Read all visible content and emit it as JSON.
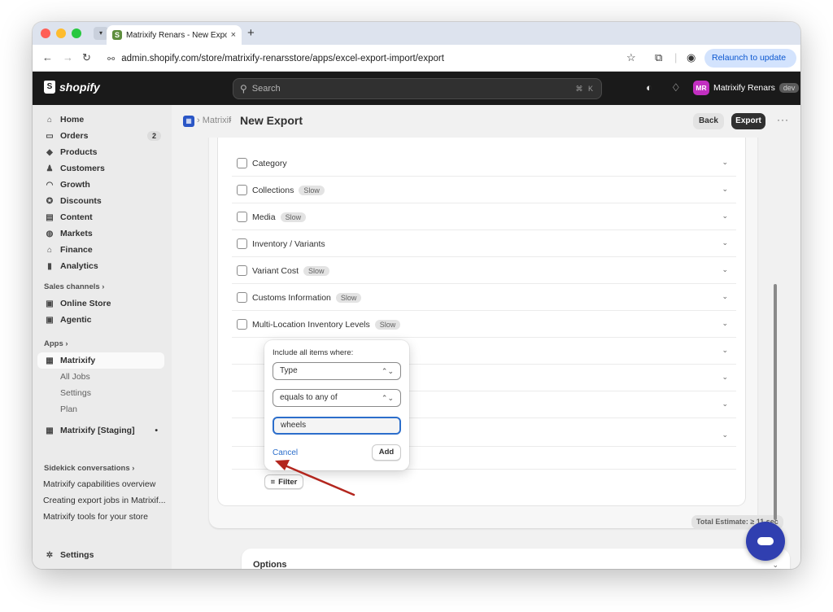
{
  "browser": {
    "tab_title": "Matrixify Renars - New Export",
    "tab_close": "×",
    "new_tab": "+",
    "url": "admin.shopify.com/store/matrixify-renarsstore/apps/excel-export-import/export",
    "relaunch_label": "Relaunch to update",
    "relaunch_menu": "⋮"
  },
  "shopify": {
    "logo_text": "shopify",
    "search_placeholder": "Search",
    "search_shortcut": "⌘ K",
    "avatar_initials": "MR",
    "store_name": "Matrixify Renars",
    "dev_badge": "dev"
  },
  "sidebar": {
    "nav": [
      {
        "label": "Home"
      },
      {
        "label": "Orders",
        "badge": "2"
      },
      {
        "label": "Products"
      },
      {
        "label": "Customers"
      },
      {
        "label": "Growth"
      },
      {
        "label": "Discounts"
      },
      {
        "label": "Content"
      },
      {
        "label": "Markets"
      },
      {
        "label": "Finance"
      },
      {
        "label": "Analytics"
      }
    ],
    "sales_channels_heading": "Sales channels ›",
    "sales_channels": [
      {
        "label": "Online Store"
      },
      {
        "label": "Agentic"
      }
    ],
    "apps_heading": "Apps ›",
    "apps": {
      "active": "Matrixify",
      "sub_items": [
        "All Jobs",
        "Settings",
        "Plan"
      ],
      "staging": "Matrixify [Staging]",
      "staging_dot": "•"
    },
    "sidekick_heading": "Sidekick conversations ›",
    "sidekick_items": [
      "Matrixify capabilities overview",
      "Creating export jobs in Matrixif...",
      "Matrixify tools for your store"
    ],
    "settings_label": "Settings"
  },
  "header": {
    "breadcrumb": "› Matrixif",
    "separator": "›",
    "title": "New Export",
    "back_label": "Back",
    "export_label": "Export",
    "more": "···"
  },
  "rows": [
    {
      "label": "Category",
      "slow": false
    },
    {
      "label": "Collections",
      "slow": true
    },
    {
      "label": "Media",
      "slow": true
    },
    {
      "label": "Inventory / Variants",
      "slow": false
    },
    {
      "label": "Variant Cost",
      "slow": true
    },
    {
      "label": "Customs Information",
      "slow": true
    },
    {
      "label": "Multi-Location Inventory Levels",
      "slow": true
    }
  ],
  "slow_label": "Slow",
  "popover": {
    "title": "Include all items where:",
    "field_select": "Type",
    "operator_select": "equals to any of",
    "value_input": "wheels",
    "cancel_label": "Cancel",
    "add_label": "Add"
  },
  "filter_label": "Filter",
  "total_estimate": "Total Estimate: ≥ 11 sec",
  "options_title": "Options",
  "colors": {
    "accent_blue": "#2c6ecb",
    "annotation_arrow": "#b3261e",
    "avatar": "#c22fc1"
  }
}
